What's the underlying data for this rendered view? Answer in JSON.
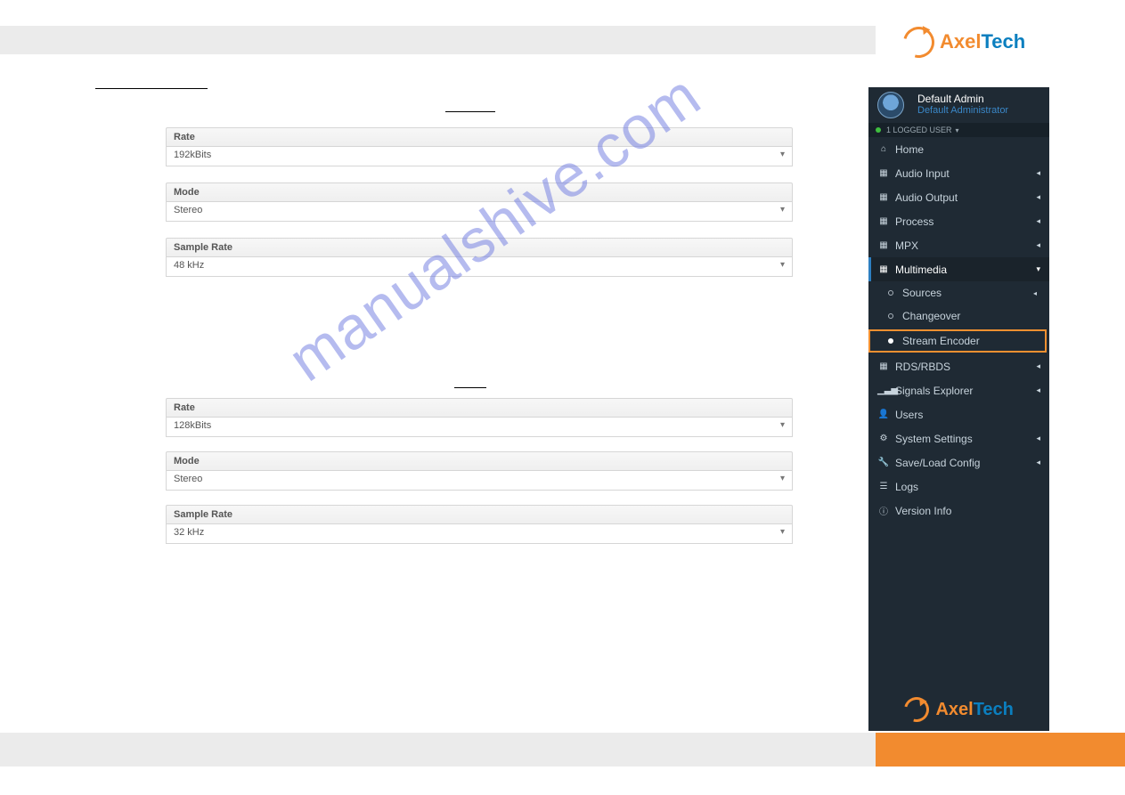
{
  "logo": {
    "first": "Axel",
    "second": "Tech"
  },
  "section1": {
    "fields": [
      {
        "label": "Rate",
        "value": "192kBits"
      },
      {
        "label": "Mode",
        "value": "Stereo"
      },
      {
        "label": "Sample Rate",
        "value": "48 kHz"
      }
    ]
  },
  "section2": {
    "fields": [
      {
        "label": "Rate",
        "value": "128kBits"
      },
      {
        "label": "Mode",
        "value": "Stereo"
      },
      {
        "label": "Sample Rate",
        "value": "32 kHz"
      }
    ]
  },
  "sidebar": {
    "user_name": "Default Admin",
    "user_role": "Default Administrator",
    "logged_bar": "1 LOGGED USER",
    "items": [
      {
        "icon": "home",
        "label": "Home",
        "caret": false
      },
      {
        "icon": "grid",
        "label": "Audio Input",
        "caret": true
      },
      {
        "icon": "grid",
        "label": "Audio Output",
        "caret": true
      },
      {
        "icon": "grid",
        "label": "Process",
        "caret": true
      },
      {
        "icon": "grid",
        "label": "MPX",
        "caret": true
      },
      {
        "icon": "grid",
        "label": "Multimedia",
        "caret": true,
        "active": true,
        "subs": [
          {
            "label": "Sources",
            "caret": true
          },
          {
            "label": "Changeover",
            "caret": false
          },
          {
            "label": "Stream Encoder",
            "highlight": true
          }
        ]
      },
      {
        "icon": "grid",
        "label": "RDS/RBDS",
        "caret": true
      },
      {
        "icon": "signal",
        "label": "Signals Explorer",
        "caret": true
      },
      {
        "icon": "user",
        "label": "Users",
        "caret": false
      },
      {
        "icon": "cogs",
        "label": "System Settings",
        "caret": true
      },
      {
        "icon": "wrench",
        "label": "Save/Load Config",
        "caret": true
      },
      {
        "icon": "list",
        "label": "Logs",
        "caret": false
      },
      {
        "icon": "info",
        "label": "Version Info",
        "caret": false
      }
    ]
  },
  "watermark": "manualshive.com"
}
